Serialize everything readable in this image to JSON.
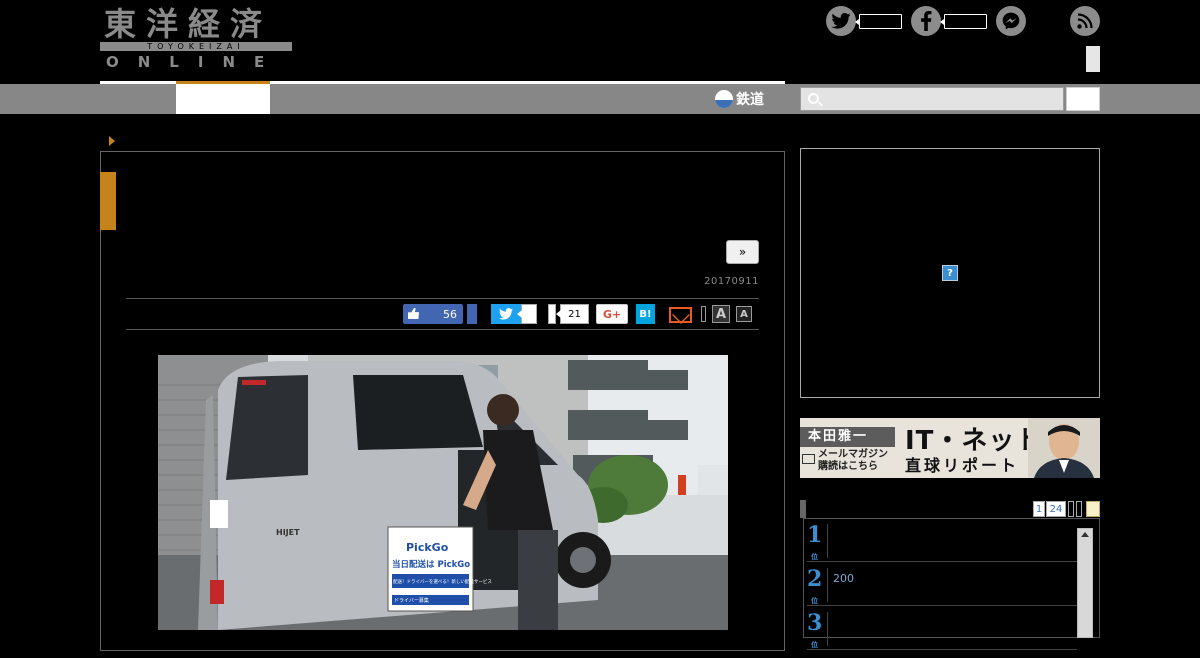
{
  "header": {
    "logo_jp": "東洋経済",
    "logo_sub": "TOYOKEIZAI",
    "logo_online": "ONLINE"
  },
  "nav": {
    "rail_label": "鉄道",
    "search_placeholder": ""
  },
  "article": {
    "next_label": "»",
    "date": "20170911",
    "share": {
      "facebook_likes": "56",
      "pocket_count": "21",
      "gplus_label": "G+",
      "hatena_label": "B!",
      "font_large": "A",
      "font_small": "A"
    },
    "photo": {
      "van_model": "HIJET",
      "sign_brand": "PickGo",
      "sign_headline": "当日配送は PickGo",
      "sign_line": "配送！ドライバーを選べる！新しい配送サービス",
      "sign_footer": "ドライバー募集"
    }
  },
  "sidebar": {
    "ad_question": "?",
    "banner": {
      "author": "本田雅一",
      "mail_line1": "メールマガジン",
      "mail_line2": "購読はこちら",
      "title": "IT・ネット",
      "subtitle": "直球リポート"
    },
    "ranking": {
      "tabs": [
        "1",
        "24"
      ],
      "items": [
        {
          "rank": "1",
          "suffix": "位",
          "text": ""
        },
        {
          "rank": "2",
          "suffix": "位",
          "text": "200"
        },
        {
          "rank": "3",
          "suffix": "位",
          "text": ""
        }
      ]
    }
  },
  "colors": {
    "accent": "#c6821b",
    "nav_gray": "#878787",
    "facebook": "#4266b2",
    "twitter": "#1da1f2",
    "hatena": "#00a4de",
    "rank_blue": "#3b8fd0"
  }
}
